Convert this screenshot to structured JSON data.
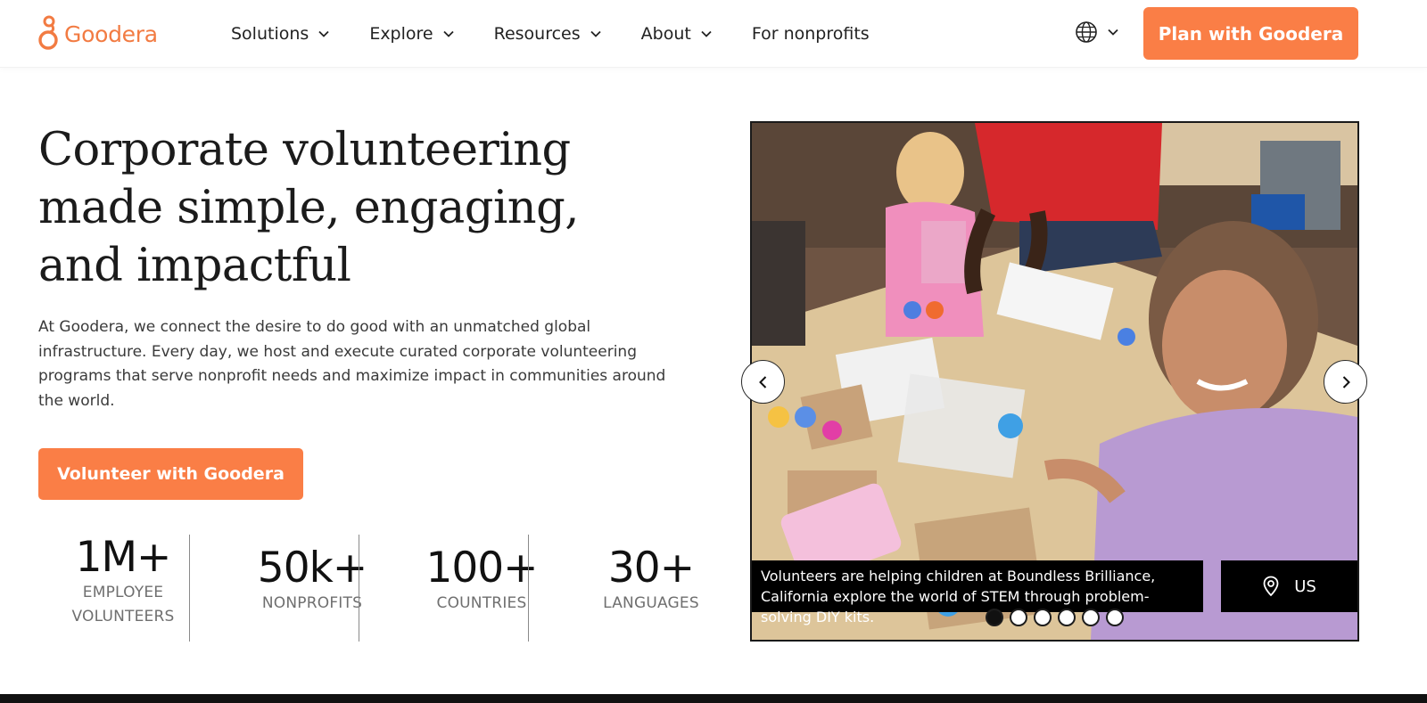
{
  "brand": {
    "name": "Goodera",
    "color": "#f27b42"
  },
  "nav": {
    "items": [
      {
        "label": "Solutions",
        "has_dropdown": true
      },
      {
        "label": "Explore",
        "has_dropdown": true
      },
      {
        "label": "Resources",
        "has_dropdown": true
      },
      {
        "label": "About",
        "has_dropdown": true
      },
      {
        "label": "For nonprofits",
        "has_dropdown": false
      }
    ],
    "language_icon": "globe-icon",
    "cta_label": "Plan with Goodera"
  },
  "hero": {
    "title_lines": [
      "Corporate volunteering",
      "made simple, engaging,",
      "and impactful"
    ],
    "description": "At Goodera, we connect the desire to do good with an unmatched global infrastructure. Every day, we host and execute curated corporate volunteering programs that serve nonprofit needs and maximize impact in communities around the world.",
    "cta_label": "Volunteer with Goodera",
    "accent_color": "#fa7e46"
  },
  "stats": [
    {
      "value": "1M+",
      "label_lines": [
        "EMPLOYEE",
        "VOLUNTEERS"
      ]
    },
    {
      "value": "50k+",
      "label_lines": [
        "NONPROFITS"
      ]
    },
    {
      "value": "100+",
      "label_lines": [
        "COUNTRIES"
      ]
    },
    {
      "value": "30+",
      "label_lines": [
        "LANGUAGES"
      ]
    }
  ],
  "carousel": {
    "caption": "Volunteers are helping children at Boundless Brilliance, California explore the world of STEM through problem-solving DIY kits.",
    "location_icon": "map-pin-icon",
    "location": "US",
    "slide_count": 6,
    "active_slide": 1,
    "prev_icon": "chevron-left-icon",
    "next_icon": "chevron-right-icon"
  }
}
